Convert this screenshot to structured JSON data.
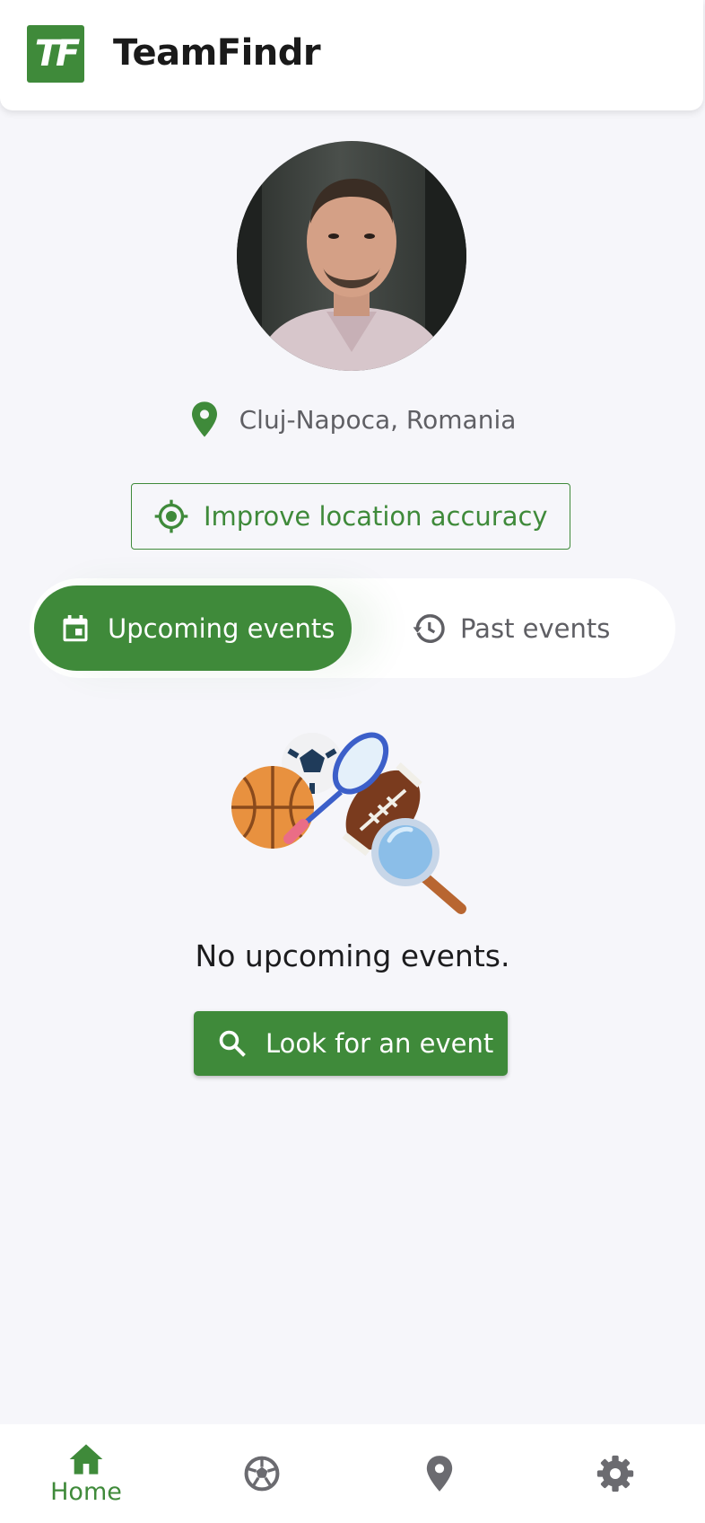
{
  "app": {
    "title": "TeamFindr",
    "logo_text": "TF"
  },
  "profile": {
    "location": "Cluj-Napoca, Romania"
  },
  "improve_location": {
    "label": "Improve location accuracy"
  },
  "tabs": [
    {
      "label": "Upcoming events",
      "icon": "calendar-icon",
      "selected": true
    },
    {
      "label": "Past events",
      "icon": "history-icon",
      "selected": false
    }
  ],
  "empty_state": {
    "message": "No upcoming events.",
    "button_label": "Look for an event",
    "illustration": "sports-balls-search-illustration"
  },
  "bottom_nav": [
    {
      "label": "Home",
      "icon": "home-icon",
      "selected": true
    },
    {
      "label": "",
      "icon": "soccer-ball-icon",
      "selected": false
    },
    {
      "label": "",
      "icon": "map-pin-icon",
      "selected": false
    },
    {
      "label": "",
      "icon": "gear-icon",
      "selected": false
    }
  ],
  "colors": {
    "primary": "#3f8a3a",
    "background": "#f6f6fa",
    "surface": "#ffffff",
    "muted_text": "#5f5f64",
    "icon_grey": "#6b6b70"
  }
}
